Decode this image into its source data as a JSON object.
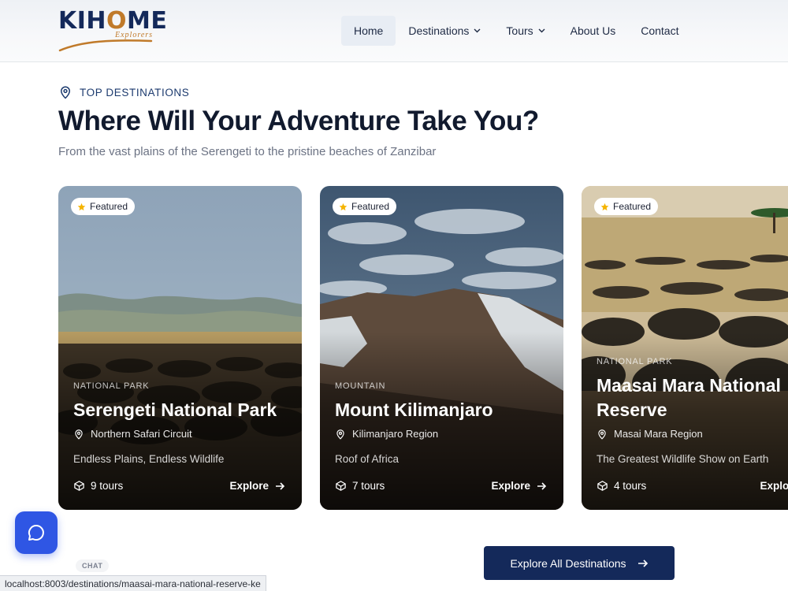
{
  "header": {
    "logo": {
      "text_a": "KIH",
      "text_o": "O",
      "text_b": "ME",
      "sub": "Explorers"
    },
    "nav": [
      {
        "label": "Home",
        "active": true,
        "dropdown": false
      },
      {
        "label": "Destinations",
        "active": false,
        "dropdown": true
      },
      {
        "label": "Tours",
        "active": false,
        "dropdown": true
      },
      {
        "label": "About Us",
        "active": false,
        "dropdown": false
      },
      {
        "label": "Contact",
        "active": false,
        "dropdown": false
      }
    ]
  },
  "section": {
    "eyebrow": "TOP DESTINATIONS",
    "title": "Where Will Your Adventure Take You?",
    "subtitle": "From the vast plains of the Serengeti to the pristine beaches of Zanzibar"
  },
  "cards": [
    {
      "badge": "Featured",
      "category": "NATIONAL PARK",
      "name": "Serengeti National Park",
      "region": "Northern Safari Circuit",
      "tagline": "Endless Plains, Endless Wildlife",
      "tours": "9 tours",
      "explore": "Explore"
    },
    {
      "badge": "Featured",
      "category": "MOUNTAIN",
      "name": "Mount Kilimanjaro",
      "region": "Kilimanjaro Region",
      "tagline": "Roof of Africa",
      "tours": "7 tours",
      "explore": "Explore"
    },
    {
      "badge": "Featured",
      "category": "NATIONAL PARK",
      "name": "Maasai Mara National Reserve",
      "region": "Masai Mara Region",
      "tagline": "The Greatest Wildlife Show on Earth",
      "tours": "4 tours",
      "explore": "Explore"
    }
  ],
  "cta": {
    "label": "Explore All Destinations"
  },
  "chat": {
    "label": "CHAT"
  },
  "status_bar": {
    "url": "localhost:8003/destinations/maasai-mara-national-reserve-ke"
  },
  "colors": {
    "brand_navy": "#14295a",
    "brand_gold": "#c07a2a",
    "chat_blue": "#2f56e4",
    "star": "#f5b400"
  }
}
